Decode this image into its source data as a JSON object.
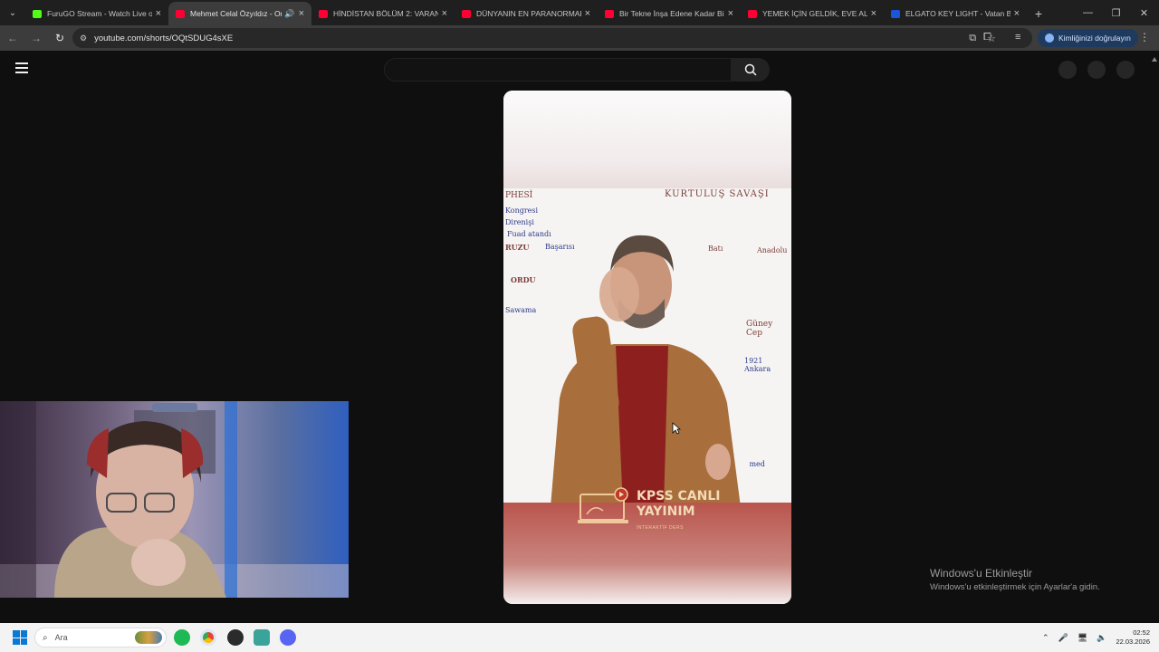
{
  "browser": {
    "tabs": [
      {
        "title": "FuruGO Stream - Watch Live on",
        "favicon_color": "#53fc18"
      },
      {
        "title": "Mehmet Celal Özyıldız - On",
        "favicon_color": "#ff0033",
        "active": true,
        "audio": true
      },
      {
        "title": "HİNDİSTAN BÖLÜM 2: VARANA",
        "favicon_color": "#ff0033"
      },
      {
        "title": "DÜNYANIN EN PARANORMAL",
        "favicon_color": "#ff0033"
      },
      {
        "title": "Bir Tekne İnşa Edene Kadar Bir",
        "favicon_color": "#ff0033"
      },
      {
        "title": "YEMEK İÇİN GELDİK, EVE ALMA",
        "favicon_color": "#ff0033"
      },
      {
        "title": "ELGATO KEY LIGHT - Vatan Bilg",
        "favicon_color": "#1a56db"
      }
    ],
    "url": "youtube.com/shorts/OQtSDUG4sXE",
    "profile_label": "Kimliğinizi doğrulayın"
  },
  "video": {
    "logo_line1": "KPSS CANLI",
    "logo_line2": "YAYINIM",
    "logo_sub": "İNTERAKTİF DERS",
    "board_words": [
      "PHESİ",
      "KURTULUŞ SAVAŞI",
      "Kongresi",
      "Direnişi",
      "Fuad atandı",
      "RUZU",
      "Başarısı",
      "ORDU",
      "Sawama",
      "Güney Cep",
      "1921 Ankara",
      "mehmed",
      "Batı",
      "Anadolu"
    ]
  },
  "watermark": {
    "line1": "Windows'u Etkinleştir",
    "line2": "Windows'u etkinleştirmek için Ayarlar'a gidin."
  },
  "taskbar": {
    "search_placeholder": "Ara",
    "time": "02:52",
    "date": "22.03.2026"
  }
}
